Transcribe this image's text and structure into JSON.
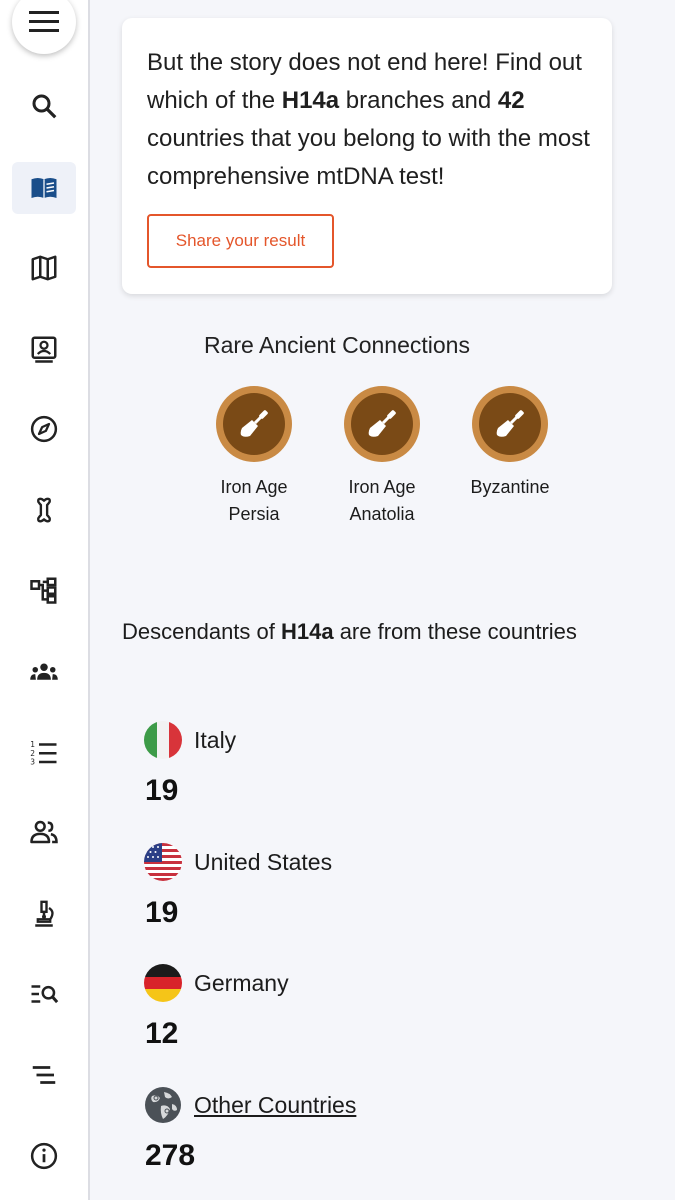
{
  "sidebar": {
    "menu_icon": "hamburger-menu-icon",
    "items": [
      {
        "icon": "search-icon"
      },
      {
        "icon": "book-open-icon",
        "active": true
      },
      {
        "icon": "map-icon"
      },
      {
        "icon": "portrait-card-icon"
      },
      {
        "icon": "compass-icon"
      },
      {
        "icon": "bone-icon"
      },
      {
        "icon": "hierarchy-tree-icon"
      },
      {
        "icon": "group-people-icon"
      },
      {
        "icon": "numbered-list-icon"
      },
      {
        "icon": "people-icon"
      },
      {
        "icon": "microscope-icon"
      },
      {
        "icon": "list-search-icon"
      },
      {
        "icon": "lines-icon"
      },
      {
        "icon": "info-icon"
      }
    ]
  },
  "card": {
    "text_1": "But the story does not end here! Find out which of the ",
    "haplogroup": "H14a",
    "text_2": " branches and ",
    "countries_count": "42",
    "text_3": " countries that you belong to with the most comprehensive mtDNA test!",
    "share_label": "Share your result"
  },
  "rare": {
    "title": "Rare Ancient Connections",
    "badges": [
      {
        "label": "Iron Age Persia",
        "icon": "trowel-icon"
      },
      {
        "label": "Iron Age Anatolia",
        "icon": "trowel-icon"
      },
      {
        "label": "Byzantine",
        "icon": "trowel-icon"
      }
    ]
  },
  "descendants": {
    "title_1": "Descendants of ",
    "haplogroup": "H14a",
    "title_2": " are from these countries",
    "countries": [
      {
        "name": "Italy",
        "count": "19",
        "flag": "italy-flag-icon"
      },
      {
        "name": "United States",
        "count": "19",
        "flag": "usa-flag-icon"
      },
      {
        "name": "Germany",
        "count": "12",
        "flag": "germany-flag-icon"
      },
      {
        "name": "Other Countries",
        "count": "278",
        "flag": "globe-icon"
      }
    ]
  },
  "colors": {
    "accent": "#e4562b",
    "active_nav": "#1a4e8a",
    "badge_outer": "#c98a44",
    "badge_inner": "#7a4a16"
  }
}
